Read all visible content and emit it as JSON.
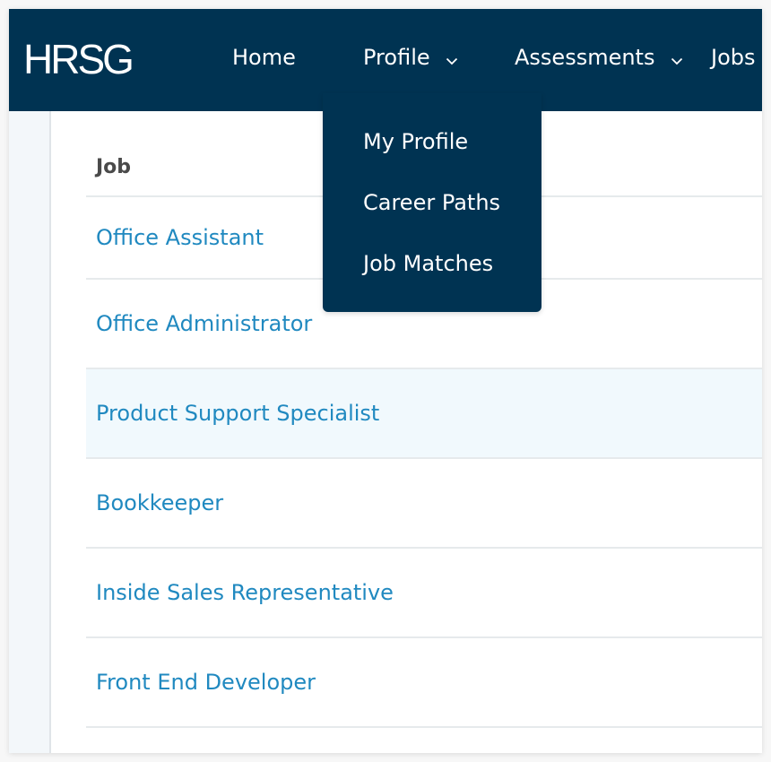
{
  "header": {
    "logo": "HRSG",
    "nav": [
      {
        "label": "Home",
        "has_dropdown": false
      },
      {
        "label": "Profile",
        "has_dropdown": true
      },
      {
        "label": "Assessments",
        "has_dropdown": true
      },
      {
        "label": "Jobs",
        "has_dropdown": false
      }
    ],
    "background_color": "#003352"
  },
  "profile_menu": {
    "items": [
      {
        "label": "My Profile"
      },
      {
        "label": "Career Paths"
      },
      {
        "label": "Job Matches"
      }
    ]
  },
  "table": {
    "column_header": "Job",
    "rows": [
      {
        "job": "Office Assistant",
        "highlighted": false
      },
      {
        "job": "Office Administrator",
        "highlighted": false
      },
      {
        "job": "Product Support Specialist",
        "highlighted": true
      },
      {
        "job": "Bookkeeper",
        "highlighted": false
      },
      {
        "job": "Inside Sales Representative",
        "highlighted": false
      },
      {
        "job": "Front End Developer",
        "highlighted": false
      }
    ],
    "link_color": "#2089c0",
    "highlight_color": "#f1f9fd"
  }
}
